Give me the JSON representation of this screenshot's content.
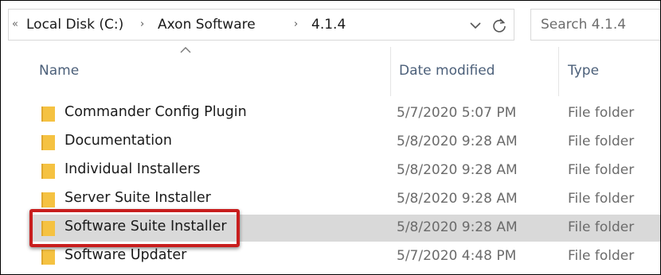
{
  "address_bar": {
    "back_glyph": "«",
    "separator": "›",
    "breadcrumbs": [
      "Local Disk (C:)",
      "Axon Software",
      "4.1.4"
    ]
  },
  "search": {
    "placeholder": "Search 4.1.4"
  },
  "columns": {
    "name": "Name",
    "date_modified": "Date modified",
    "type": "Type"
  },
  "files": [
    {
      "name": "Commander Config Plugin",
      "date": "5/7/2020 5:07 PM",
      "type": "File folder"
    },
    {
      "name": "Documentation",
      "date": "5/8/2020 9:28 AM",
      "type": "File folder"
    },
    {
      "name": "Individual Installers",
      "date": "5/8/2020 9:28 AM",
      "type": "File folder"
    },
    {
      "name": "Server Suite Installer",
      "date": "5/8/2020 9:28 AM",
      "type": "File folder"
    },
    {
      "name": "Software Suite Installer",
      "date": "5/8/2020 9:28 AM",
      "type": "File folder",
      "selected": true
    },
    {
      "name": "Software Updater",
      "date": "5/7/2020 4:48 PM",
      "type": "File folder"
    }
  ],
  "colors": {
    "folder": "#f5c242",
    "folder_tab": "#e0a82e",
    "selection": "#d9d9d9",
    "highlight": "#c81e1e",
    "header_text": "#4c607a"
  }
}
